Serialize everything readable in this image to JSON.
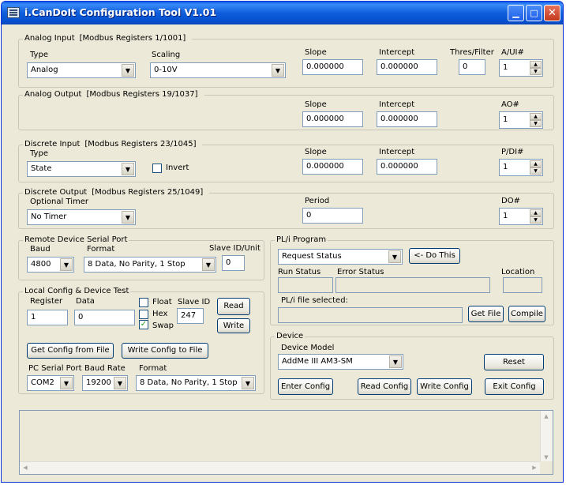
{
  "window": {
    "title": "i.CanDoIt Configuration Tool V1.01"
  },
  "analog_input": {
    "title": "Analog Input",
    "registers": "[Modbus Registers 1/1001]",
    "type_label": "Type",
    "type_value": "Analog",
    "scaling_label": "Scaling",
    "scaling_value": "0-10V",
    "slope_label": "Slope",
    "slope_value": "0.000000",
    "intercept_label": "Intercept",
    "intercept_value": "0.000000",
    "thres_label": "Thres/Filter",
    "thres_value": "0",
    "index_label": "A/UI#",
    "index_value": "1"
  },
  "analog_output": {
    "title": "Analog Output",
    "registers": "[Modbus Registers 19/1037]",
    "slope_label": "Slope",
    "slope_value": "0.000000",
    "intercept_label": "Intercept",
    "intercept_value": "0.000000",
    "index_label": "AO#",
    "index_value": "1"
  },
  "discrete_input": {
    "title": "Discrete Input",
    "registers": "[Modbus Registers 23/1045]",
    "type_label": "Type",
    "type_value": "State",
    "invert_label": "Invert",
    "slope_label": "Slope",
    "slope_value": "0.000000",
    "intercept_label": "Intercept",
    "intercept_value": "0.000000",
    "index_label": "P/DI#",
    "index_value": "1"
  },
  "discrete_output": {
    "title": "Discrete Output",
    "registers": "[Modbus Registers 25/1049]",
    "timer_label": "Optional Timer",
    "timer_value": "No Timer",
    "period_label": "Period",
    "period_value": "0",
    "index_label": "DO#",
    "index_value": "1"
  },
  "remote_port": {
    "title": "Remote Device Serial Port",
    "baud_label": "Baud",
    "baud_value": "4800",
    "format_label": "Format",
    "format_value": "8 Data, No Parity, 1 Stop",
    "slave_label": "Slave ID/Unit",
    "slave_value": "0"
  },
  "local_config": {
    "title": "Local Config & Device Test",
    "register_label": "Register",
    "register_value": "1",
    "data_label": "Data",
    "data_value": "0",
    "float_label": "Float",
    "hex_label": "Hex",
    "swap_label": "Swap",
    "slave_label": "Slave ID",
    "slave_value": "247",
    "read_button": "Read",
    "write_button": "Write",
    "get_config_button": "Get Config from File",
    "write_config_button": "Write Config to File",
    "pc_port_label": "PC Serial Port",
    "pc_port_value": "COM2",
    "baud_label": "Baud Rate",
    "baud_value": "19200",
    "format_label": "Format",
    "format_value": "8 Data, No Parity, 1 Stop"
  },
  "pli_program": {
    "title": "PL/i Program",
    "request_value": "Request Status",
    "do_this_button": "<- Do This",
    "run_status_label": "Run Status",
    "error_status_label": "Error Status",
    "location_label": "Location",
    "file_selected_label": "PL/i file selected:",
    "get_file_button": "Get File",
    "compile_button": "Compile"
  },
  "device": {
    "title": "Device",
    "model_label": "Device Model",
    "model_value": "AddMe III AM3-SM",
    "reset_button": "Reset",
    "enter_config_button": "Enter Config",
    "read_config_button": "Read Config",
    "write_config_button": "Write Config",
    "exit_config_button": "Exit Config"
  },
  "icons": {
    "dropdown": "▼",
    "spin_up": "▲",
    "spin_down": "▼",
    "check": "✓"
  }
}
